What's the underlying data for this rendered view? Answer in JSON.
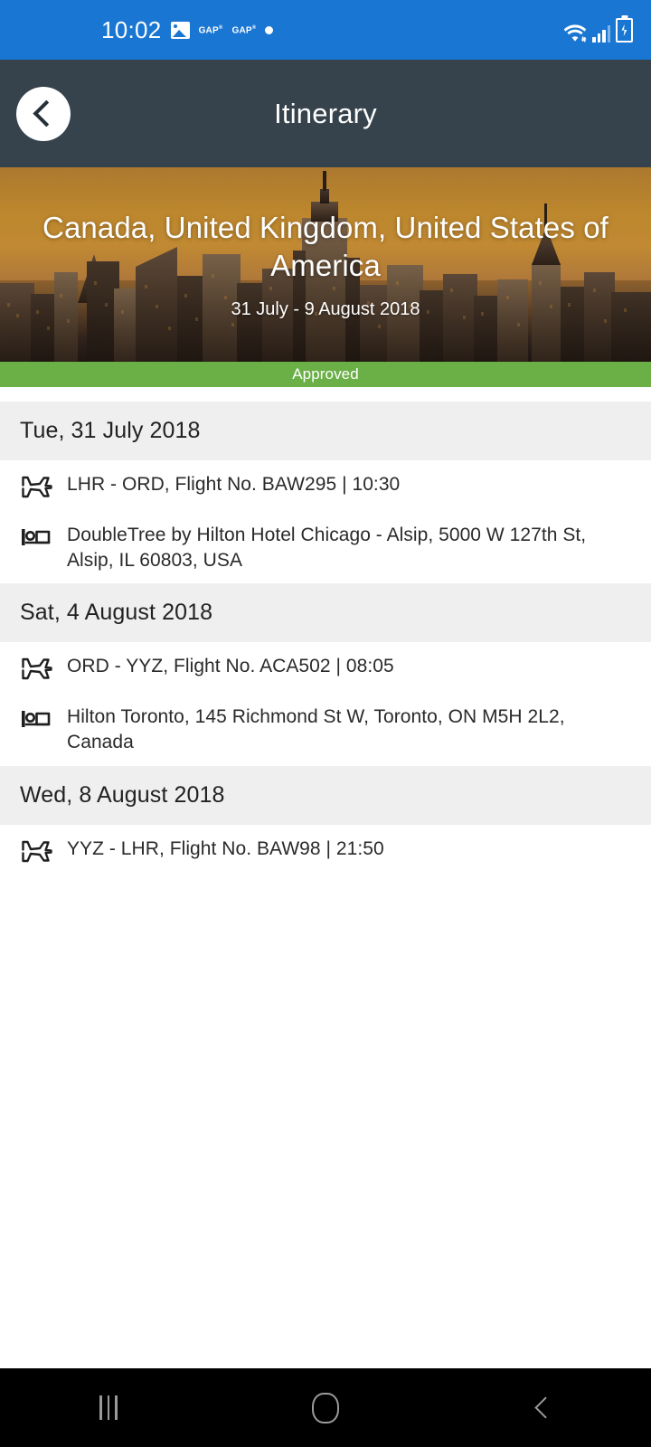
{
  "status_bar": {
    "time": "10:02",
    "icons": [
      "image-icon",
      "gap-badge",
      "gap-badge",
      "dot-indicator"
    ],
    "gap_label": "GAP",
    "gap_sup": "®",
    "right_icons": [
      "wifi-icon",
      "signal-icon",
      "battery-charging-icon"
    ],
    "background_color": "#1976D2"
  },
  "app_bar": {
    "title": "Itinerary",
    "back_icon": "chevron-left-icon",
    "background_color": "#36434D"
  },
  "hero": {
    "title": "Canada, United Kingdom, United States of America",
    "dates": "31 July - 9 August 2018",
    "image_description": "city-skyline-sunset"
  },
  "status_strip": {
    "label": "Approved",
    "color": "#6BAF47"
  },
  "itinerary": {
    "days": [
      {
        "date_label": "Tue, 31 July 2018",
        "entries": [
          {
            "icon": "flight-icon",
            "text": "LHR - ORD, Flight No. BAW295 | 10:30"
          },
          {
            "icon": "hotel-bed-icon",
            "text": "DoubleTree by Hilton Hotel Chicago - Alsip, 5000 W 127th St, Alsip, IL 60803, USA"
          }
        ]
      },
      {
        "date_label": "Sat, 4 August 2018",
        "entries": [
          {
            "icon": "flight-icon",
            "text": "ORD - YYZ, Flight No. ACA502 | 08:05"
          },
          {
            "icon": "hotel-bed-icon",
            "text": "Hilton Toronto, 145 Richmond St W, Toronto, ON M5H 2L2, Canada"
          }
        ]
      },
      {
        "date_label": "Wed, 8 August 2018",
        "entries": [
          {
            "icon": "flight-icon",
            "text": "YYZ - LHR, Flight No. BAW98 | 21:50"
          }
        ]
      }
    ]
  },
  "nav_bar": {
    "recents_label": "recents-icon",
    "home_label": "home-icon",
    "back_label": "back-icon"
  }
}
